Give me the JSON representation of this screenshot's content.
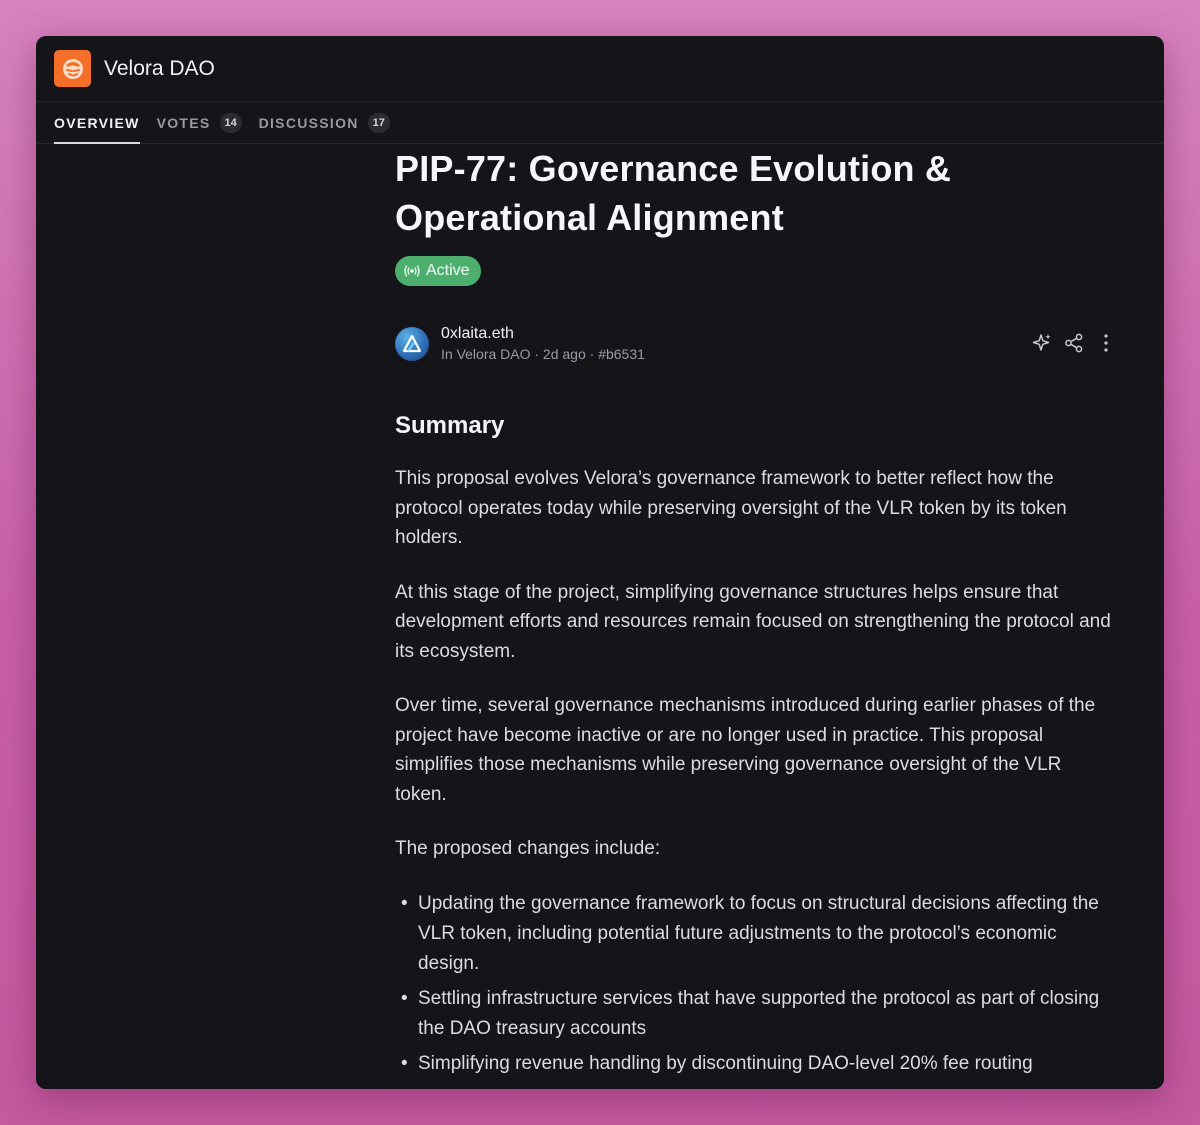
{
  "app": {
    "name": "Velora DAO"
  },
  "tabs": [
    {
      "label": "OVERVIEW"
    },
    {
      "label": "VOTES",
      "count": "14"
    },
    {
      "label": "DISCUSSION",
      "count": "17"
    }
  ],
  "proposal": {
    "title": "PIP-77: Governance Evolution & Operational Alignment",
    "status": "Active",
    "author": "0xlaita.eth",
    "meta": "In Velora DAO · 2d ago · #b6531"
  },
  "icons": {
    "logo": "tiger-logo-icon",
    "status": "broadcast-icon",
    "ai": "sparkle-icon",
    "share": "share-icon",
    "more": "more-vertical-icon"
  },
  "body": {
    "summary_heading": "Summary",
    "paragraphs": [
      "This proposal evolves Velora’s governance framework to better reflect how the protocol operates today while preserving oversight of the VLR token by its token holders.",
      "At this stage of the project, simplifying governance structures helps ensure that development efforts and resources remain focused on strengthening the protocol and its ecosystem.",
      "Over time, several governance mechanisms introduced during earlier phases of the project have become inactive or are no longer used in practice. This proposal simplifies those mechanisms while preserving governance oversight of the VLR token.",
      "The proposed changes include:"
    ],
    "bullets": [
      "Updating the governance framework to focus on structural decisions affecting the VLR token, including potential future adjustments to the protocol’s economic design.",
      "Settling infrastructure services that have supported the protocol as part of closing the DAO treasury accounts",
      "Simplifying revenue handling by discontinuing DAO-level 20% fee routing"
    ]
  },
  "colors": {
    "background": "#151419",
    "accent_logo": "#f36f2a",
    "status_active": "#4caf6e"
  }
}
